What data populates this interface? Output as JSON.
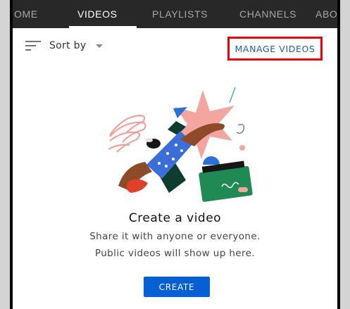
{
  "tabs": [
    {
      "label": "OME",
      "active": false
    },
    {
      "label": "VIDEOS",
      "active": true
    },
    {
      "label": "PLAYLISTS",
      "active": false
    },
    {
      "label": "CHANNELS",
      "active": false
    },
    {
      "label": "ABO",
      "active": false
    }
  ],
  "toolbar": {
    "sort_icon": "sort-lines-icon",
    "sort_label": "Sort by",
    "sort_caret_icon": "caret-down-icon",
    "manage_label": "MANAGE VIDEOS"
  },
  "empty_state": {
    "illustration_icon": "create-video-illustration",
    "title": "Create a video",
    "line1": "Share it with anyone or everyone.",
    "line2": "Public videos will show up here.",
    "button_label": "CREATE"
  },
  "colors": {
    "tabbar_bg": "#282828",
    "accent_blue": "#065fd4",
    "highlight_red": "#e8000d",
    "link_blue": "#1b5ea8"
  }
}
